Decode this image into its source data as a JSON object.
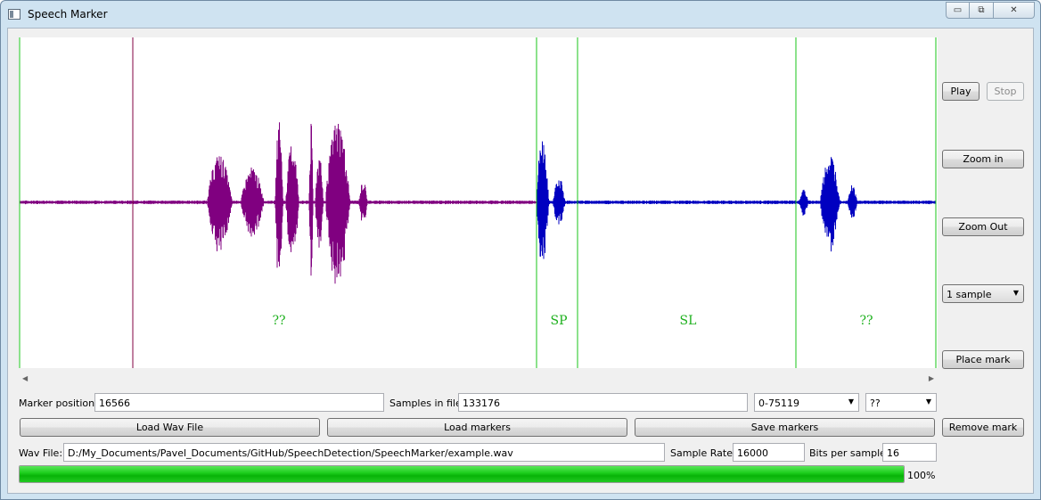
{
  "window": {
    "title": "Speech Marker"
  },
  "titlebar_buttons": {
    "minimize": "▭",
    "maximize": "⧉",
    "close": "✕"
  },
  "waveform": {
    "segments": [
      {
        "label": "??",
        "color": "#800080"
      },
      {
        "label": "SP",
        "color": "#0000c0"
      },
      {
        "label": "SL",
        "color": "#0000c0"
      },
      {
        "label": "??",
        "color": "#0000c0"
      }
    ],
    "marker_color": "#19c519",
    "cursor_color": "#800040",
    "label_color": "#1db01d"
  },
  "side": {
    "play": "Play",
    "stop": "Stop",
    "zoom_in": "Zoom in",
    "zoom_out": "Zoom Out",
    "step_select": "1 sample",
    "place_mark": "Place mark",
    "remove_mark": "Remove mark"
  },
  "fields": {
    "marker_position_label": "Marker position:",
    "marker_position_value": "16566",
    "samples_label": "Samples in file:",
    "samples_value": "133176",
    "range_select": "0-75119",
    "mark_type_select": "??",
    "wav_file_label": "Wav File:",
    "wav_file_value": "D:/My_Documents/Pavel_Documents/GitHub/SpeechDetection/SpeechMarker/example.wav",
    "sample_rate_label": "Sample Rate:",
    "sample_rate_value": "16000",
    "bits_label": "Bits per sample:",
    "bits_value": "16"
  },
  "buttons": {
    "load_wav": "Load Wav File",
    "load_markers": "Load markers",
    "save_markers": "Save markers"
  },
  "progress": {
    "fraction": 1.0,
    "text": "100%"
  }
}
